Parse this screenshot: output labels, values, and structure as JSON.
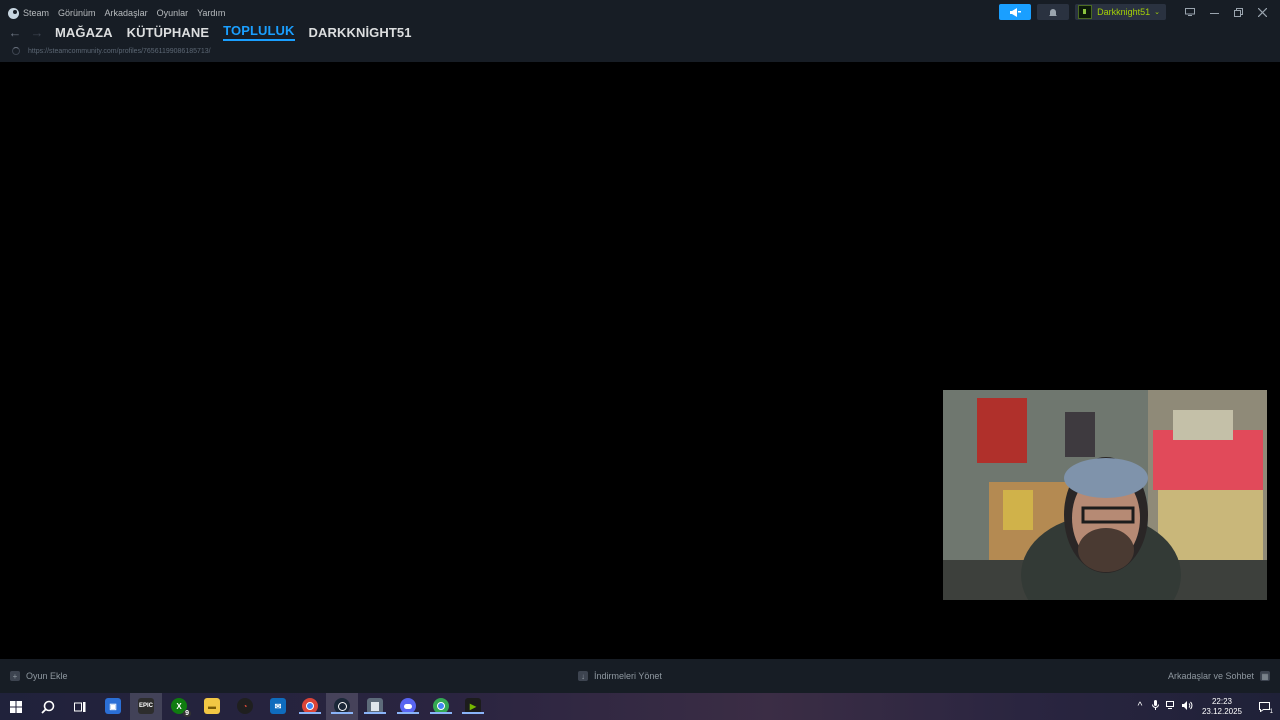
{
  "menu": {
    "app_name": "Steam",
    "items": [
      "Görünüm",
      "Arkadaşlar",
      "Oyunlar",
      "Yardım"
    ]
  },
  "header": {
    "announce_icon": "megaphone-icon",
    "bell_icon": "bell-icon",
    "account_name": "Darkknight51",
    "account_chevron": "⌄"
  },
  "nav": {
    "back": "←",
    "forward": "→",
    "tabs": [
      {
        "label": "MAĞAZA",
        "active": false
      },
      {
        "label": "KÜTÜPHANE",
        "active": false
      },
      {
        "label": "TOPLULUK",
        "active": true
      },
      {
        "label": "DARKKNİGHT51",
        "active": false
      }
    ],
    "url": "https://steamcommunity.com/profiles/76561199086185713/"
  },
  "bottombar": {
    "add_game": "Oyun Ekle",
    "manage_downloads": "İndirmeleri Yönet",
    "friends_chat": "Arkadaşlar ve Sohbet"
  },
  "taskbar": {
    "apps": [
      {
        "name": "windows-start-icon",
        "glyph": "⊞"
      },
      {
        "name": "search-icon",
        "glyph": "⚲"
      },
      {
        "name": "task-view-icon",
        "glyph": "❐"
      },
      {
        "name": "store-icon",
        "glyph": "🛍"
      },
      {
        "name": "epic-games-icon",
        "glyph": "EPIC"
      },
      {
        "name": "xbox-icon",
        "glyph": "X",
        "badge": "9"
      },
      {
        "name": "file-explorer-icon",
        "glyph": "▬"
      },
      {
        "name": "speedometer-icon",
        "glyph": "◔"
      },
      {
        "name": "outlook-icon",
        "glyph": "✉"
      },
      {
        "name": "chrome-icon",
        "glyph": "◉"
      },
      {
        "name": "steam-icon",
        "glyph": "⚙"
      },
      {
        "name": "notepad-icon",
        "glyph": "▤"
      },
      {
        "name": "discord-icon",
        "glyph": "◕"
      },
      {
        "name": "chrome-profile-icon",
        "glyph": "◉"
      },
      {
        "name": "nvidia-icon",
        "glyph": "▶"
      }
    ],
    "time": "22:23",
    "date": "23.12.2025",
    "notification_count": "1"
  },
  "colors": {
    "steam_blue": "#1a9fff",
    "account_green": "#a4d007",
    "background": "#171d25"
  }
}
